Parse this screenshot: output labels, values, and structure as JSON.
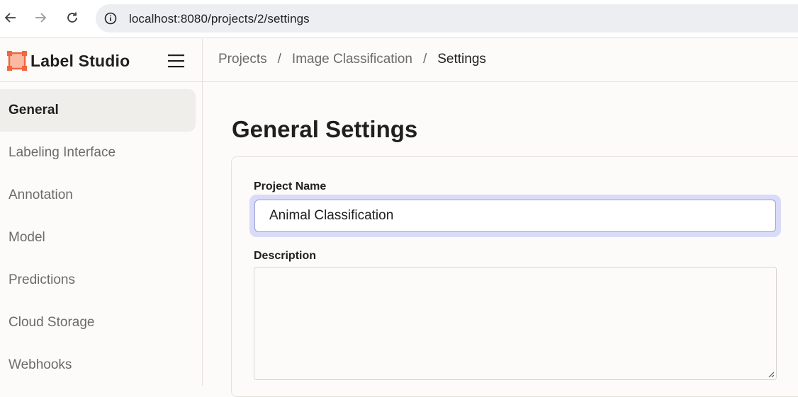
{
  "browser": {
    "url": "localhost:8080/projects/2/settings"
  },
  "header": {
    "logo_text": "Label Studio",
    "breadcrumb": [
      {
        "label": "Projects"
      },
      {
        "label": "Image Classification"
      },
      {
        "label": "Settings"
      }
    ],
    "separator": "/"
  },
  "sidebar": {
    "items": [
      {
        "label": "General",
        "active": true
      },
      {
        "label": "Labeling Interface"
      },
      {
        "label": "Annotation"
      },
      {
        "label": "Model"
      },
      {
        "label": "Predictions"
      },
      {
        "label": "Cloud Storage"
      },
      {
        "label": "Webhooks"
      }
    ]
  },
  "main": {
    "title": "General Settings",
    "project_name_label": "Project Name",
    "project_name_value": "Animal Classification",
    "description_label": "Description",
    "description_value": ""
  },
  "colors": {
    "brand": "#f0663f",
    "focus_ring": "#d9dbf7"
  }
}
